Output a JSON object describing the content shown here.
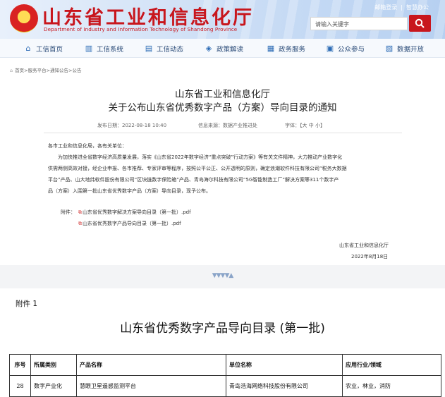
{
  "header": {
    "site_title": "山东省工业和信息化厅",
    "site_subtitle": "Department of Industry and Information Technology of Shandong Province",
    "top_links": [
      "邮箱登录",
      "智慧办公"
    ],
    "search_placeholder": "请输入关键字"
  },
  "nav": {
    "items": [
      {
        "label": "工信首页",
        "icon": "home-icon"
      },
      {
        "label": "工信系统",
        "icon": "building-icon"
      },
      {
        "label": "工信动态",
        "icon": "news-icon"
      },
      {
        "label": "政策解读",
        "icon": "policy-icon"
      },
      {
        "label": "政务服务",
        "icon": "service-icon"
      },
      {
        "label": "公众参与",
        "icon": "participate-icon"
      },
      {
        "label": "数据开放",
        "icon": "data-icon"
      }
    ]
  },
  "breadcrumb": "首页>服务平台>通知公告>公告",
  "article": {
    "org": "山东省工业和信息化厅",
    "title": "关于公布山东省优秀数字产品（方案）导向目录的通知",
    "publish_date": "发布日期：2022-08-18 10:40",
    "source": "信息来源：数据产业推进处",
    "font_size": "字体：【大 中 小】",
    "addressee": "各市工业和信息化局，各有关单位：",
    "body_lines": [
      "为加快推进全省数字经济高质量发展，落实《山东省2022年数字经济“重点突破”行动方案》等有关文件精神，大力推动产业数字化",
      "供需两侧高效对接，经企业申报、各市推荐、专家评审等程序，按照公平公正、公开透明的原则，确定浪潮软件科技有限公司“税务大数据",
      "平台”产品、山大地纬软件股份有限公司“区块链数字保险箱”产品、青岛海尔科技有限公司“5G智能制造工厂”解决方案等311个数字产",
      "品（方案）入围第一批山东省优秀数字产品（方案）导向目录，现予公布。"
    ],
    "attachment_label": "附件：",
    "attachments": [
      "山东省优秀数字解决方案导向目录（第一批）.pdf",
      "山东省优秀数字产品导向目录（第一批）.pdf"
    ],
    "signature_org": "山东省工业和信息化厅",
    "signature_date": "2022年8月18日"
  },
  "attachment_page": {
    "number": "附件 1",
    "title": "山东省优秀数字产品导向目录 (第一批)",
    "columns": [
      "序号",
      "所属类别",
      "产品名称",
      "单位名称",
      "应用行业/领域"
    ],
    "rows": [
      [
        "28",
        "数字产业化",
        "慧眼卫星遥感监测平台",
        "青岛浩海网络科技股份有限公司",
        "农业，林业，消防"
      ]
    ]
  },
  "colors": {
    "brand_red": "#c8161d",
    "nav_text": "#2a4b78"
  }
}
